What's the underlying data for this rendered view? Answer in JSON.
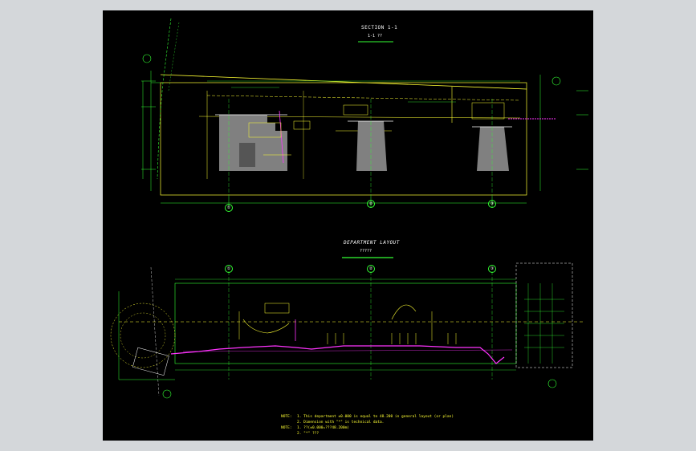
{
  "section_view": {
    "title": "SECTION 1-1",
    "subtitle": "1-1 ??",
    "axis_labels": [
      "①",
      "②",
      "③"
    ]
  },
  "plan_view": {
    "title": "DEPARTMENT LAYOUT",
    "subtitle": "?????",
    "axis_labels": [
      "①",
      "②",
      "③"
    ]
  },
  "notes": {
    "heading1": "NOTE:",
    "line1": "1. This department ±0.000 is equal to  48.200 in general layout (or plan)",
    "line2": "2. Dimension with \"*\" is technical data.",
    "heading2": "NOTE:",
    "line3": "1. ??(±0.000=???48.200m)",
    "line4": "2. \"*\" ???"
  },
  "colors": {
    "background": "#000000",
    "frame": "#d4d7da",
    "line_green": "#33ff33",
    "line_yellow": "#ffff33",
    "line_magenta": "#ff33ff",
    "text_white": "#ffffff",
    "solid_gray": "#808080"
  }
}
